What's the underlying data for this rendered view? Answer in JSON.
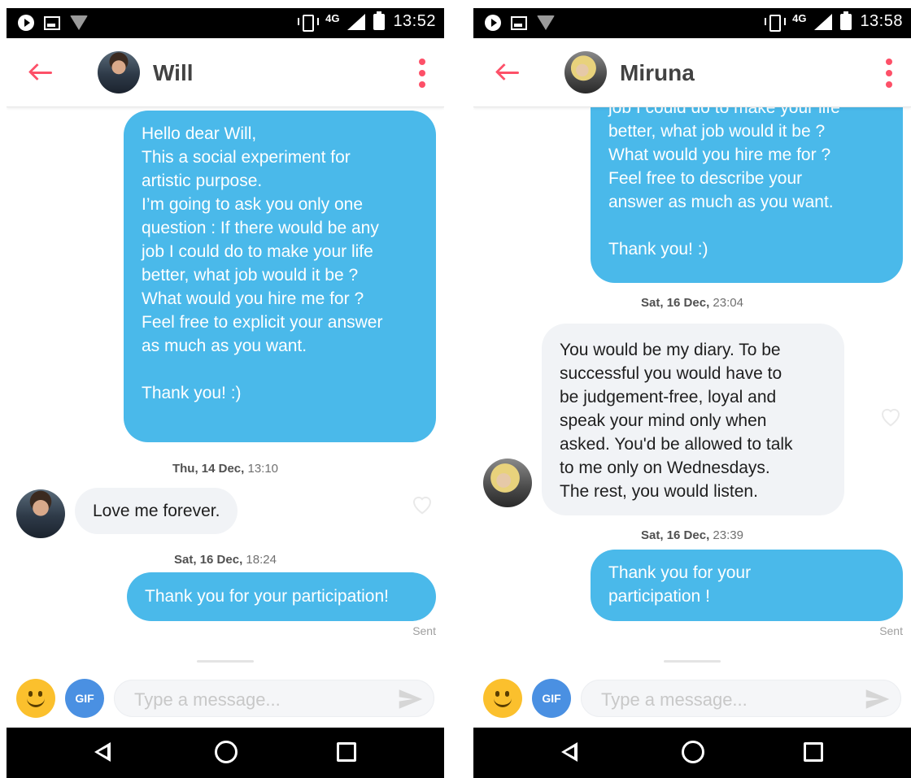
{
  "screens": [
    {
      "status": {
        "network": "4G",
        "time": "13:52"
      },
      "header": {
        "name": "Will"
      },
      "bubbles": {
        "intro": "Hello dear Will,\nThis a social experiment for\nartistic purpose.\nI’m going to ask you only one\nquestion : If there would be any\njob I could do to make your life\nbetter, what job would it be ?\nWhat would you hire me for ?\nFeel free to explicit your answer\nas much as you want.\n\nThank you! :)",
        "stamp1_day": "Thu, 14 Dec,",
        "stamp1_time": "13:10",
        "reply": "Love me forever.",
        "stamp2_day": "Sat, 16 Dec,",
        "stamp2_time": "18:24",
        "thanks": "Thank you for your participation!",
        "sent": "Sent"
      },
      "composer": {
        "gif": "GIF",
        "placeholder": "Type a message..."
      }
    },
    {
      "status": {
        "network": "4G",
        "time": "13:58"
      },
      "header": {
        "name": "Miruna"
      },
      "bubbles": {
        "intro": "job I could do to make your life\nbetter, what job would it be ?\nWhat would you hire me for ?\nFeel free to describe your\nanswer as much as you want.\n\nThank you! :)",
        "stamp1_day": "Sat, 16 Dec,",
        "stamp1_time": "23:04",
        "reply": "You would be my diary. To be\nsuccessful you would have to\nbe judgement-free, loyal and\nspeak your mind only when\nasked. You'd be allowed to talk\nto me only on Wednesdays.\nThe rest, you would listen.",
        "stamp2_day": "Sat, 16 Dec,",
        "stamp2_time": "23:39",
        "thanks": "Thank you for your\nparticipation !",
        "sent": "Sent"
      },
      "composer": {
        "gif": "GIF",
        "placeholder": "Type a message..."
      }
    }
  ],
  "colors": {
    "accent": "#fd5068",
    "outgoing_bubble": "#4ab9ea",
    "incoming_bubble": "#f1f3f6",
    "emoji": "#fbc02d",
    "gif": "#4a90e2"
  },
  "icons": [
    "play-notification-icon",
    "image-notification-icon",
    "wifi-icon",
    "vibrate-icon",
    "signal-icon",
    "battery-icon",
    "back-arrow-icon",
    "more-vert-icon",
    "heart-icon",
    "emoji-icon",
    "send-icon",
    "nav-back-icon",
    "nav-home-icon",
    "nav-recents-icon"
  ]
}
